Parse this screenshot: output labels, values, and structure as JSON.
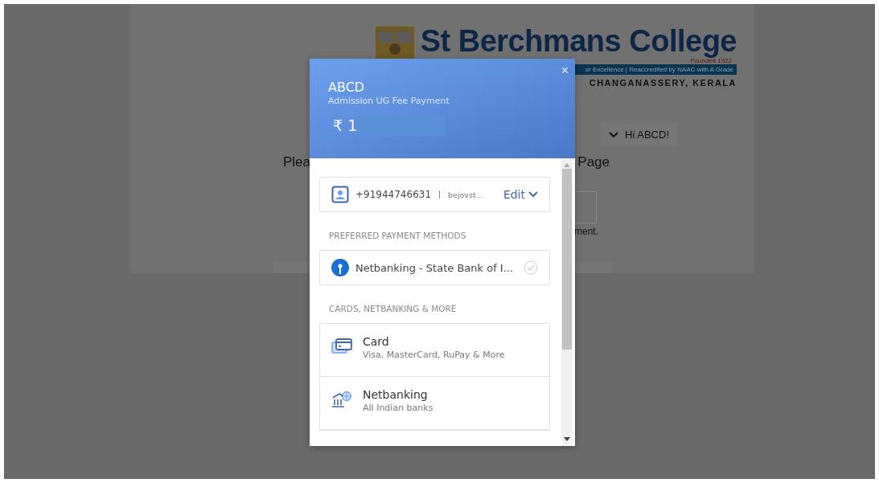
{
  "page": {
    "college_name": "St Berchmans College",
    "founded": "Founded 1922",
    "tagline": "or Excellence | Reaccredited by NAAC with A Grade",
    "location": "CHANGANASSERY, KERALA",
    "user_menu": "Hi ABCD!",
    "message_start": "Plea",
    "message_end": "Page",
    "note": "ment."
  },
  "checkout": {
    "close": "×",
    "merchant": "ABCD",
    "description": "Admission UG Fee Payment",
    "amount": "₹ 1",
    "contact": {
      "phone": "+91944746631",
      "email": "bejovst...",
      "edit": "Edit"
    },
    "preferred_heading": "PREFERRED PAYMENT METHODS",
    "preferred": [
      {
        "label": "Netbanking - State Bank of I...",
        "selected": false
      }
    ],
    "methods_heading": "CARDS, NETBANKING & MORE",
    "methods": [
      {
        "kind": "card",
        "title": "Card",
        "subtitle": "Visa, MasterCard, RuPay & More"
      },
      {
        "kind": "netbanking",
        "title": "Netbanking",
        "subtitle": "All Indian banks"
      }
    ]
  }
}
